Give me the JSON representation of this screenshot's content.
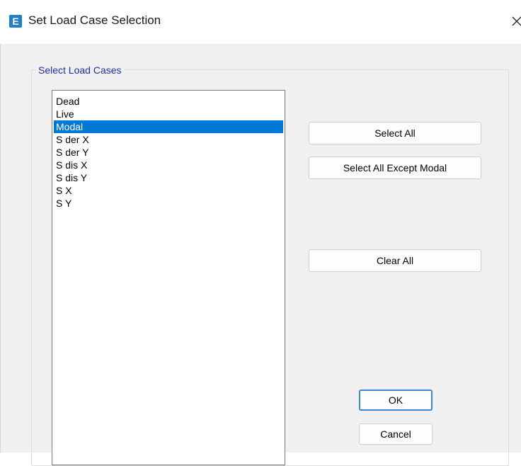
{
  "window": {
    "icon_letter": "E",
    "title": "Set Load Case Selection",
    "close_glyph": "×"
  },
  "group": {
    "label": "Select Load Cases"
  },
  "load_cases": {
    "items": [
      {
        "label": "Dead",
        "selected": false
      },
      {
        "label": "Live",
        "selected": false
      },
      {
        "label": "Modal",
        "selected": true
      },
      {
        "label": "S der X",
        "selected": false
      },
      {
        "label": "S der Y",
        "selected": false
      },
      {
        "label": "S dis X",
        "selected": false
      },
      {
        "label": "S dis Y",
        "selected": false
      },
      {
        "label": "S X",
        "selected": false
      },
      {
        "label": "S Y",
        "selected": false
      }
    ]
  },
  "buttons": {
    "select_all": "Select All",
    "select_all_except_modal": "Select All Except Modal",
    "clear_all": "Clear All",
    "ok": "OK",
    "cancel": "Cancel"
  },
  "colors": {
    "accent_selection": "#0078d7",
    "app_icon": "#1e7ec8",
    "group_label": "#1f2fa8",
    "default_button_border": "#3d86d6"
  },
  "icons": {
    "app": "etabs-app-icon",
    "close": "close-icon"
  }
}
